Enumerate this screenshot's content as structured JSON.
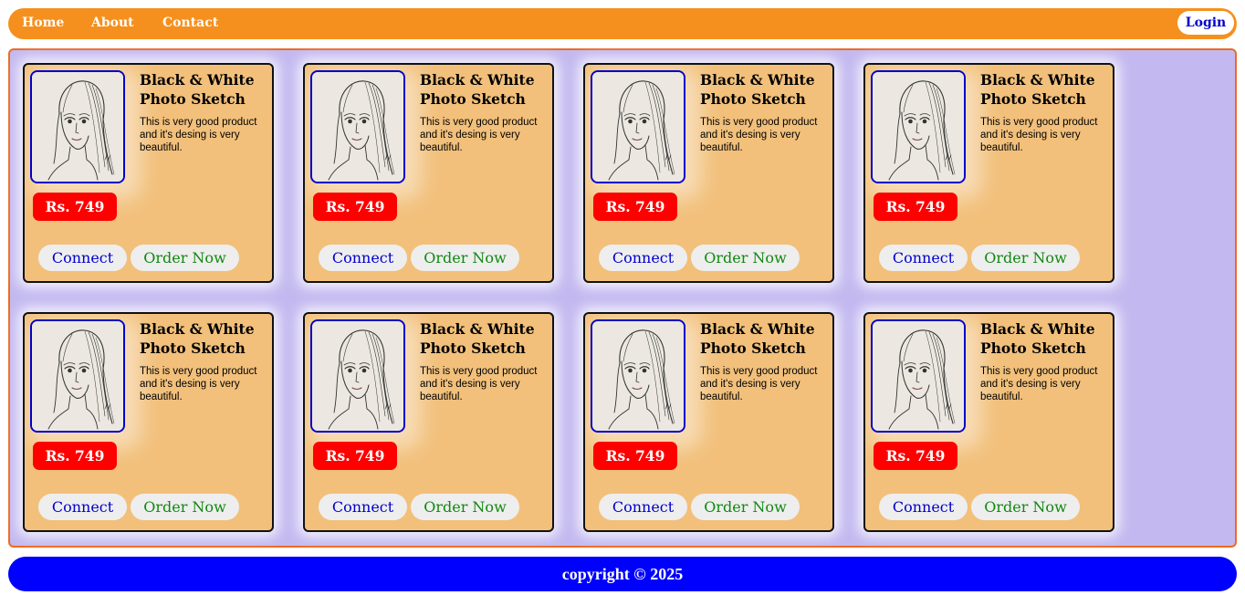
{
  "nav": {
    "links": [
      "Home",
      "About",
      "Contact"
    ],
    "login_label": "Login"
  },
  "products": [
    {
      "title": "Black & White Photo Sketch",
      "description": "This is very good product\nand it's desing is very\nbeautiful.",
      "price": "Rs. 749",
      "connect_label": "Connect",
      "order_label": "Order Now"
    },
    {
      "title": "Black & White Photo Sketch",
      "description": "This is very good product\nand it's desing is very\nbeautiful.",
      "price": "Rs. 749",
      "connect_label": "Connect",
      "order_label": "Order Now"
    },
    {
      "title": "Black & White Photo Sketch",
      "description": "This is very good product\nand it's desing is very\nbeautiful.",
      "price": "Rs. 749",
      "connect_label": "Connect",
      "order_label": "Order Now"
    },
    {
      "title": "Black & White Photo Sketch",
      "description": "This is very good product\nand it's desing is very\nbeautiful.",
      "price": "Rs. 749",
      "connect_label": "Connect",
      "order_label": "Order Now"
    },
    {
      "title": "Black & White Photo Sketch",
      "description": "This is very good product\nand it's desing is very\nbeautiful.",
      "price": "Rs. 749",
      "connect_label": "Connect",
      "order_label": "Order Now"
    },
    {
      "title": "Black & White Photo Sketch",
      "description": "This is very good product\nand it's desing is very\nbeautiful.",
      "price": "Rs. 749",
      "connect_label": "Connect",
      "order_label": "Order Now"
    },
    {
      "title": "Black & White Photo Sketch",
      "description": "This is very good product\nand it's desing is very\nbeautiful.",
      "price": "Rs. 749",
      "connect_label": "Connect",
      "order_label": "Order Now"
    },
    {
      "title": "Black & White Photo Sketch",
      "description": "This is very good product\nand it's desing is very\nbeautiful.",
      "price": "Rs. 749",
      "connect_label": "Connect",
      "order_label": "Order Now"
    }
  ],
  "footer": {
    "text": "copyright © 2025"
  },
  "colors": {
    "navbar": "#f5901e",
    "main_bg": "#c3b9f0",
    "main_border": "#ee6a22",
    "card_bg": "#f2c07b",
    "price_bg": "#ff0000",
    "connect_text": "#0000cc",
    "order_text": "#118811",
    "footer_bg": "#0000ff"
  },
  "icons": {
    "product_image": "sketch-portrait-image"
  }
}
